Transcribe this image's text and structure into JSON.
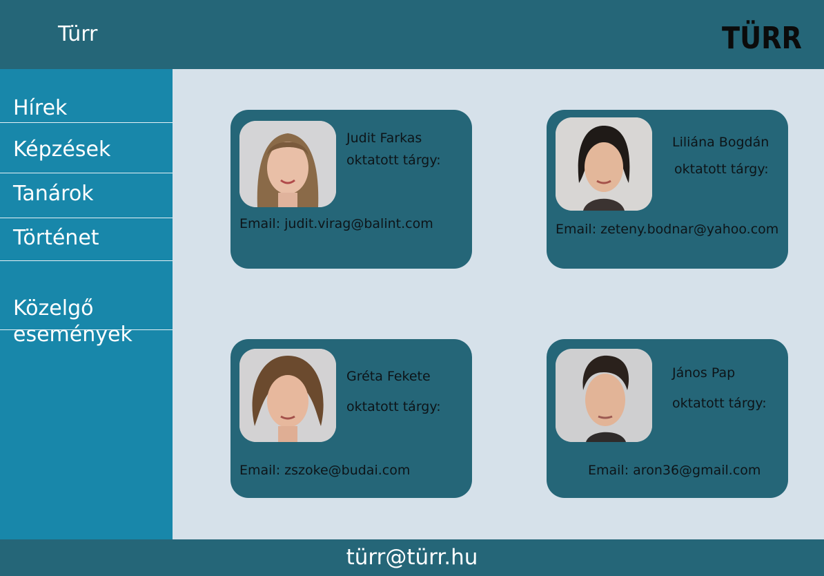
{
  "header": {
    "title": "Türr",
    "logo_text": "TÜRR",
    "logo_icon": "turr-logo-icon"
  },
  "sidebar": {
    "items": [
      {
        "label": "Hírek"
      },
      {
        "label": "Képzések"
      },
      {
        "label": "Tanárok"
      },
      {
        "label": "Történet"
      },
      {
        "label": "Közelgő\nesemények"
      }
    ]
  },
  "teachers": [
    {
      "name": "Judit Farkas",
      "subject_label": "oktatott tárgy:",
      "email": "Email: judit.virag@balint.com",
      "photo_icon": "woman-portrait-icon"
    },
    {
      "name": "Liliána Bogdán",
      "subject_label": "oktatott tárgy:",
      "email": "Email: zeteny.bodnar@yahoo.com",
      "photo_icon": "woman-portrait-icon"
    },
    {
      "name": "Gréta Fekete",
      "subject_label": "oktatott tárgy:",
      "email": "Email: zszoke@budai.com",
      "photo_icon": "woman-portrait-icon"
    },
    {
      "name": "János Pap",
      "subject_label": "oktatott tárgy:",
      "email": "Email: aron36@gmail.com",
      "photo_icon": "man-portrait-icon"
    }
  ],
  "footer": {
    "email": "türr@türr.hu"
  },
  "colors": {
    "header": "#256678",
    "sidebar": "#1887aa",
    "main_bg": "#d6e1ea",
    "card": "#256678"
  }
}
